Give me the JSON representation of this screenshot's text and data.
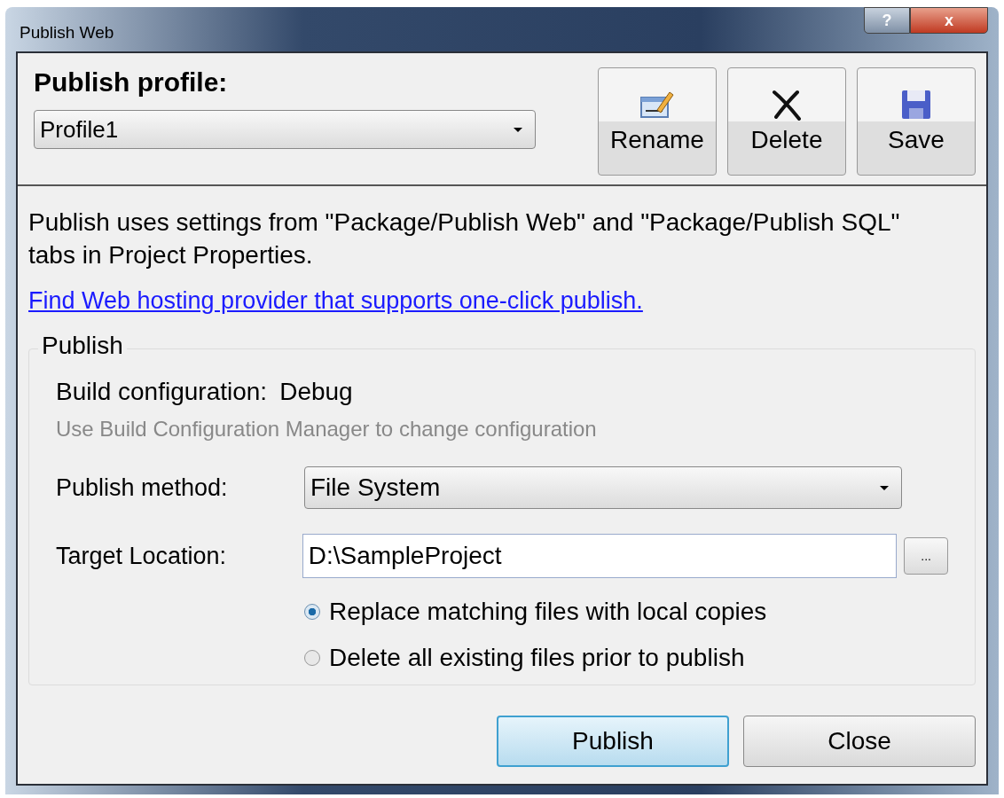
{
  "window": {
    "title": "Publish Web",
    "help": "?",
    "close": "x"
  },
  "profile": {
    "label": "Publish profile:",
    "value": "Profile1"
  },
  "toolbar": [
    {
      "label": "Rename",
      "kind": "rename"
    },
    {
      "label": "Delete",
      "kind": "delete"
    },
    {
      "label": "Save",
      "kind": "save"
    }
  ],
  "info": "Publish uses settings from \"Package/Publish Web\" and \"Package/Publish SQL\" tabs in Project Properties.",
  "link": "Find Web hosting provider that supports one-click publish.",
  "group": {
    "title": "Publish",
    "build_label": "Build configuration:",
    "build_value": "Debug",
    "hint": "Use Build Configuration Manager to change configuration",
    "method_label": "Publish method:",
    "method_value": "File System",
    "target_label": "Target Location:",
    "target_value": "D:\\SampleProject",
    "browse": "...",
    "options": [
      {
        "label": "Replace matching files with local copies",
        "selected": true
      },
      {
        "label": "Delete all existing files prior to publish",
        "selected": false
      }
    ]
  },
  "buttons": [
    {
      "label": "Publish",
      "default": true
    },
    {
      "label": "Close",
      "default": false
    }
  ]
}
